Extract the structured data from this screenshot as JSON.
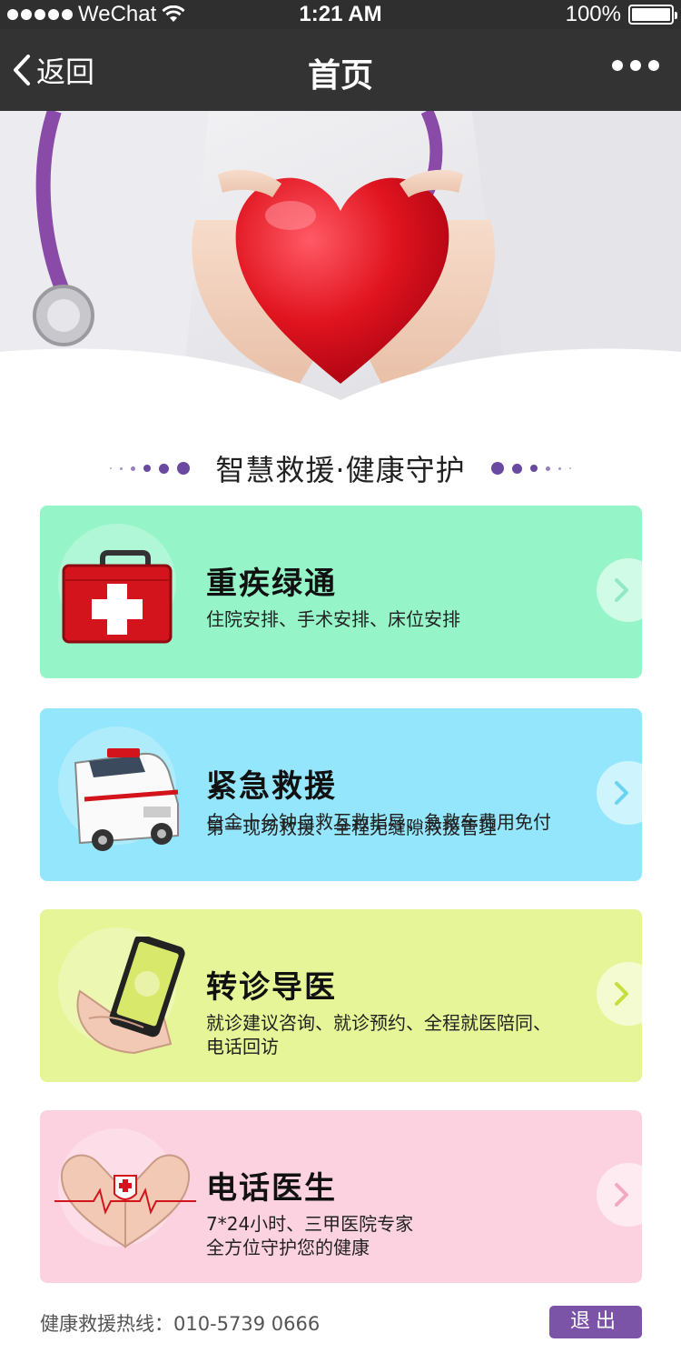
{
  "status_bar": {
    "carrier": "WeChat",
    "time": "1:21 AM",
    "battery": "100%",
    "battery_level": 1.0
  },
  "nav": {
    "back_label": "返回",
    "title": "首页"
  },
  "slogan": "智慧救援·健康守护",
  "cards": [
    {
      "title": "重疾绿通",
      "desc_lines": [
        "住院安排、手术安排、床位安排"
      ],
      "bg_color": "#95f5c9",
      "arrow_color": "#8fe9c4",
      "icon": "first-aid-kit-icon"
    },
    {
      "title": "紧急救援",
      "desc_lines": [
        "白金十分钟自救互救指导、急救车费用免付",
        "第一现场救援、全程无缝隙救援管理"
      ],
      "bg_color": "#93e6fb",
      "arrow_color": "#6ad3f0",
      "icon": "ambulance-icon"
    },
    {
      "title": "转诊导医",
      "desc_lines": [
        "就诊建议咨询、就诊预约、全程就医陪同、",
        "电话回访"
      ],
      "bg_color": "#e6f597",
      "arrow_color": "#c7df3c",
      "icon": "phone-in-hand-icon"
    },
    {
      "title": "电话医生",
      "desc_lines": [
        "7*24小时、三甲医院专家",
        "全方位守护您的健康"
      ],
      "bg_color": "#fcd2e1",
      "arrow_color": "#f4a9c3",
      "icon": "heart-hands-icon"
    }
  ],
  "footer": {
    "hotline_label": "健康救援热线：",
    "hotline_number": "010-5739 0666",
    "logout_label": "退出"
  },
  "colors": {
    "accent": "#7c54a7",
    "nav_bg": "#333333"
  }
}
